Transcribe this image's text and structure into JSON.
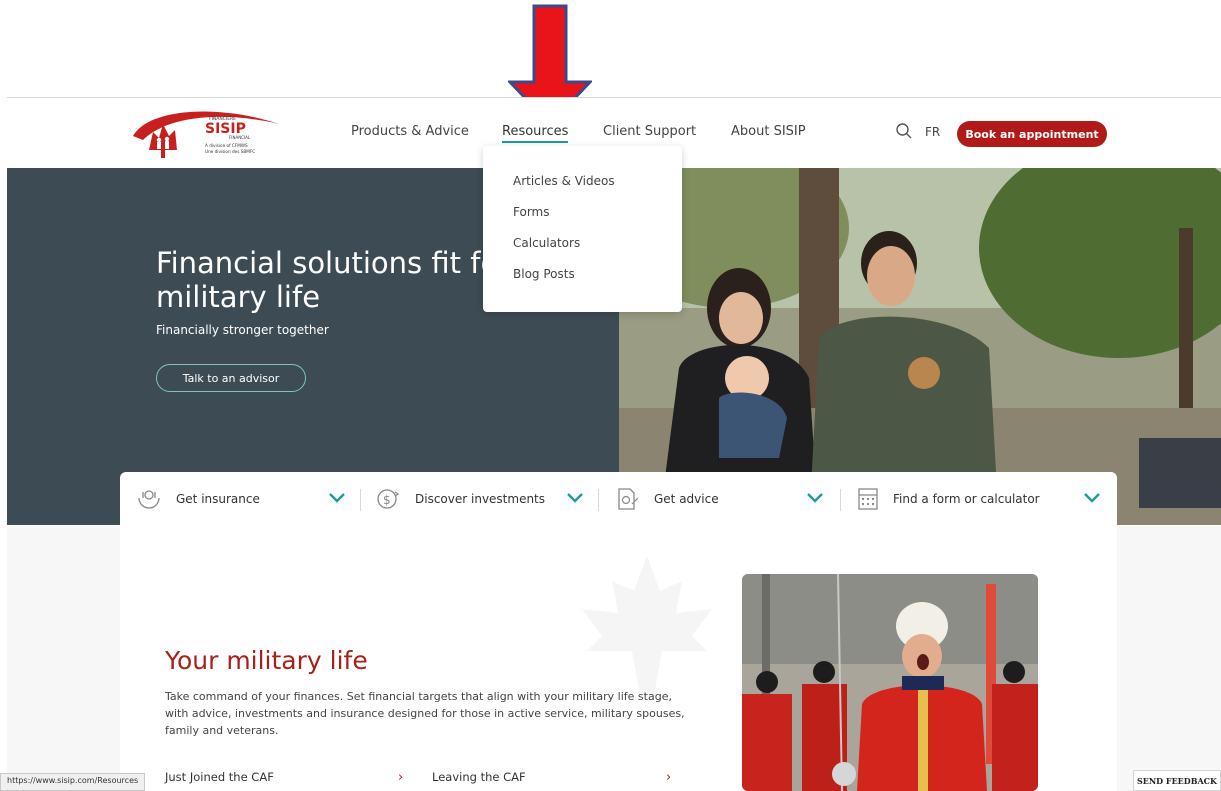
{
  "brand": {
    "name": "SISIP",
    "sub_top": "FINANCIÈRE",
    "sub_bottom": "FINANCIAL",
    "division_en": "A division of CFMWS",
    "division_fr": "Une division des SBMFC",
    "color_red": "#b21a1a",
    "color_teal": "#1e9b9d"
  },
  "nav": {
    "items": [
      "Products & Advice",
      "Resources",
      "Client Support",
      "About SISIP"
    ],
    "active": "Resources",
    "lang": "FR",
    "book_label": "Book an appointment"
  },
  "dropdown": {
    "items": [
      "Articles & Videos",
      "Forms",
      "Calculators",
      "Blog Posts"
    ]
  },
  "hero": {
    "title": "Financial solutions fit for military life",
    "subtitle": "Financially stronger together",
    "cta": "Talk to an advisor"
  },
  "quickbar": {
    "items": [
      {
        "label": "Get insurance",
        "icon": "hands-insurance-icon"
      },
      {
        "label": "Discover investments",
        "icon": "dollar-coin-icon"
      },
      {
        "label": "Get advice",
        "icon": "document-advice-icon"
      },
      {
        "label": "Find a form or calculator",
        "icon": "calculator-icon"
      }
    ]
  },
  "section": {
    "title": "Your military life",
    "text": "Take command of your finances. Set financial targets that align with your military life stage, with advice, investments and insurance designed for those in active service, military spouses, family and veterans.",
    "links": [
      "Just Joined the CAF",
      "Leaving the CAF"
    ]
  },
  "status": {
    "url": "https://www.sisip.com/Resources"
  },
  "feedback": {
    "label": "SEND FEEDBACK"
  }
}
